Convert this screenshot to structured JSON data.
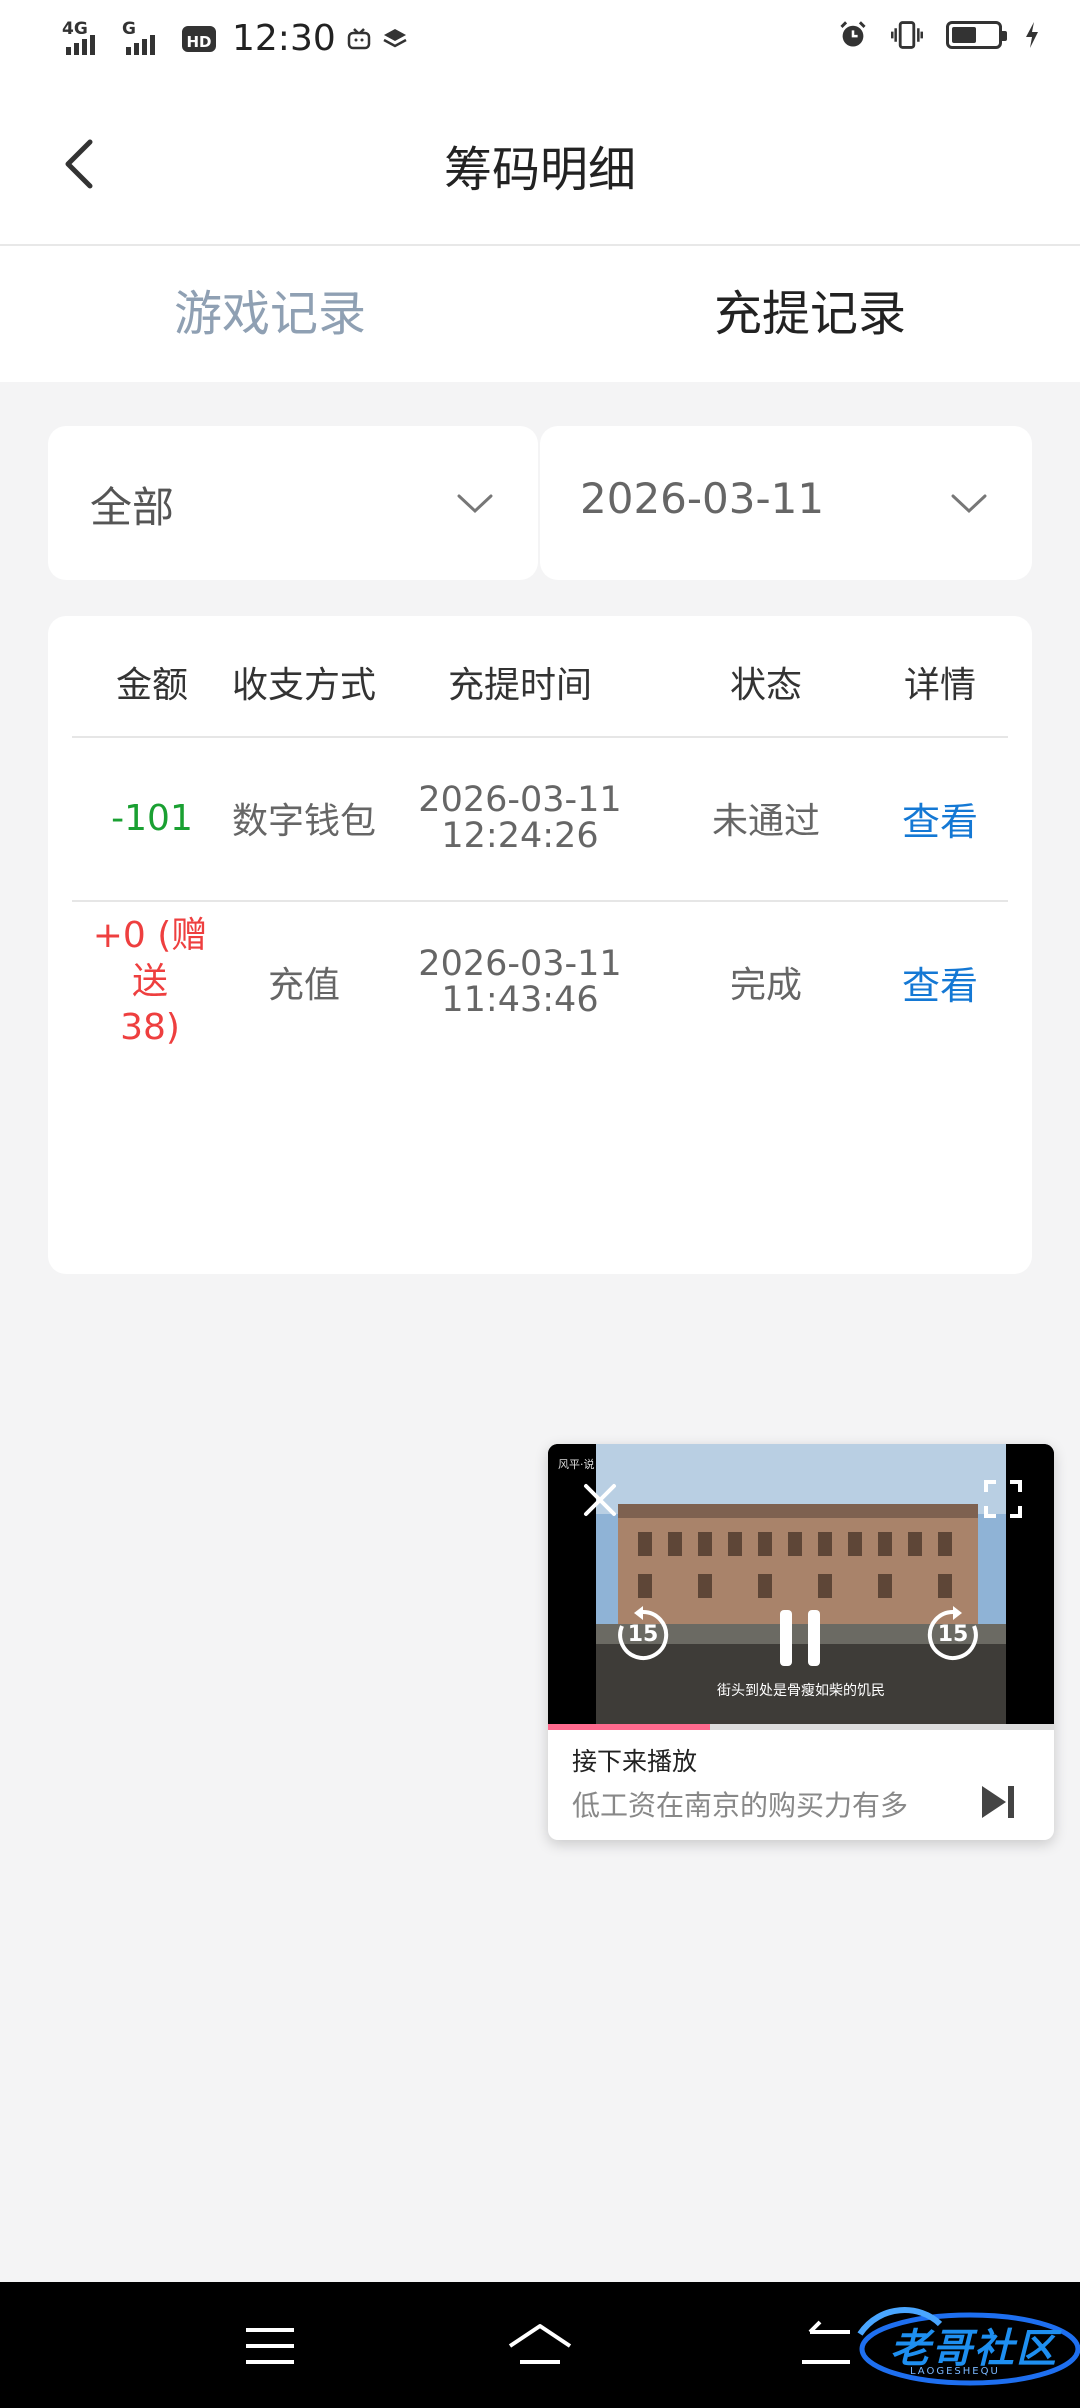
{
  "status_bar": {
    "time": "12:30",
    "net1": "4G",
    "net2": "G",
    "hd": "HD",
    "battery_level": 0.55
  },
  "header": {
    "title": "筹码明细"
  },
  "tabs": [
    {
      "label": "游戏记录",
      "active": false
    },
    {
      "label": "充提记录",
      "active": true
    }
  ],
  "filters": {
    "type_value": "全部",
    "date_value": "2026-03-11"
  },
  "table": {
    "columns": [
      "金额",
      "收支方式",
      "充提时间",
      "状态",
      "详情"
    ],
    "rows": [
      {
        "amount": "-101",
        "method": "数字钱包",
        "date": "2026-03-11",
        "time": "12:24:26",
        "status": "未通过",
        "detail": "查看"
      },
      {
        "amount_line1": "+0 (赠送",
        "amount_line2": "38)",
        "method": "充值",
        "date": "2026-03-11",
        "time": "11:43:46",
        "status": "完成",
        "detail": "查看"
      }
    ]
  },
  "video_player": {
    "tag": "风平·说",
    "subtitle": "街头到处是骨瘦如柴的饥民",
    "rewind_seconds": "15",
    "forward_seconds": "15",
    "progress": 0.32,
    "next_label": "接下来播放",
    "next_title": "低工资在南京的购买力有多"
  },
  "watermark": {
    "text": "老哥社区",
    "sub": "LAOGESHEQU"
  },
  "colors": {
    "negative": "#1aa032",
    "positive": "#ee3f3f",
    "link": "#1478d4",
    "tab_inactive": "#8fa0b3"
  }
}
